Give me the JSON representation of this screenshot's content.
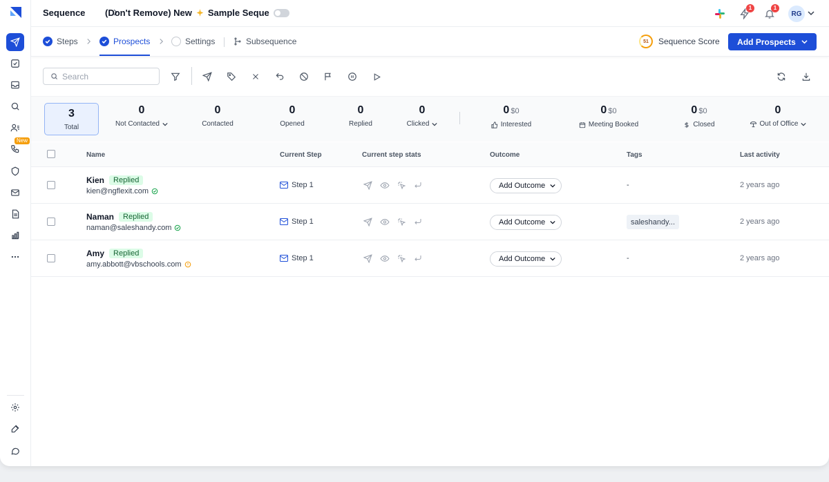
{
  "colors": {
    "primary": "#1d4ed8",
    "replied_bg": "#dcfce7",
    "replied_text": "#166534",
    "notification": "#ef4444",
    "score": "#f59e0b"
  },
  "sidebar": {
    "new_badge": "New",
    "icons": [
      "send-icon",
      "tasks-icon",
      "inbox-icon",
      "search-icon",
      "prospects-icon",
      "calls-icon",
      "shield-icon",
      "mail-icon",
      "templates-icon",
      "reports-icon",
      "more-icon",
      "settings-icon",
      "feedback-icon",
      "chat-icon"
    ]
  },
  "header": {
    "breadcrumb_root": "Sequence",
    "breadcrumb_current": "(Don't Remove) New",
    "breadcrumb_current_suffix": "Sample Seque",
    "lightning_count": "1",
    "bell_count": "1",
    "avatar_initials": "RG"
  },
  "tabs": {
    "steps": "Steps",
    "prospects": "Prospects",
    "settings": "Settings",
    "subsequence": "Subsequence",
    "score_value": "51",
    "score_label": "Sequence Score",
    "add_prospects": "Add Prospects"
  },
  "toolbar": {
    "search_placeholder": "Search"
  },
  "stats": {
    "total": {
      "value": "3",
      "label": "Total"
    },
    "not_contacted": {
      "value": "0",
      "label": "Not Contacted"
    },
    "contacted": {
      "value": "0",
      "label": "Contacted"
    },
    "opened": {
      "value": "0",
      "label": "Opened"
    },
    "replied": {
      "value": "0",
      "label": "Replied"
    },
    "clicked": {
      "value": "0",
      "label": "Clicked"
    },
    "interested": {
      "value": "0",
      "amount": "$0",
      "label": "Interested"
    },
    "meeting_booked": {
      "value": "0",
      "amount": "$0",
      "label": "Meeting Booked"
    },
    "closed": {
      "value": "0",
      "amount": "$0",
      "label": "Closed"
    },
    "out_of_office": {
      "value": "0",
      "label": "Out of Office"
    }
  },
  "table": {
    "headers": {
      "name": "Name",
      "current_step": "Current Step",
      "step_stats": "Current step stats",
      "outcome": "Outcome",
      "tags": "Tags",
      "last_activity": "Last activity"
    },
    "rows": [
      {
        "name": "Kien",
        "status": "Replied",
        "email": "kien@ngflexit.com",
        "verified": "verified",
        "step": "Step 1",
        "outcome": "Add Outcome",
        "tags": "-",
        "last_activity": "2 years ago"
      },
      {
        "name": "Naman",
        "status": "Replied",
        "email": "naman@saleshandy.com",
        "verified": "verified",
        "step": "Step 1",
        "outcome": "Add Outcome",
        "tags": "saleshandy...",
        "last_activity": "2 years ago"
      },
      {
        "name": "Amy",
        "status": "Replied",
        "email": "amy.abbott@vbschools.com",
        "verified": "risky",
        "step": "Step 1",
        "outcome": "Add Outcome",
        "tags": "-",
        "last_activity": "2 years ago"
      }
    ]
  }
}
